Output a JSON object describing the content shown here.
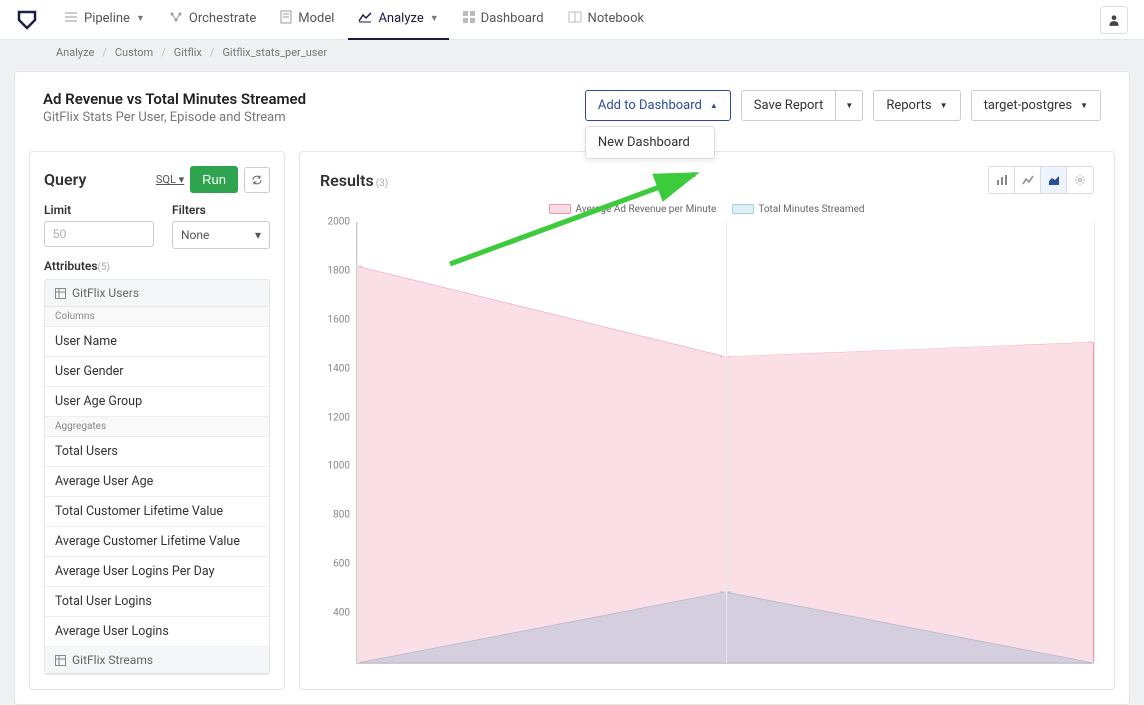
{
  "nav": {
    "items": [
      {
        "label": "Pipeline",
        "dropdown": true
      },
      {
        "label": "Orchestrate",
        "dropdown": false
      },
      {
        "label": "Model",
        "dropdown": false
      },
      {
        "label": "Analyze",
        "dropdown": true,
        "active": true
      },
      {
        "label": "Dashboard",
        "dropdown": false
      },
      {
        "label": "Notebook",
        "dropdown": false
      }
    ]
  },
  "breadcrumb": [
    "Analyze",
    "Custom",
    "Gitflix",
    "Gitflix_stats_per_user"
  ],
  "page": {
    "title": "Ad Revenue vs Total Minutes Streamed",
    "subtitle": "GitFlix Stats Per User, Episode and Stream"
  },
  "actions": {
    "add_to_dashboard": "Add to Dashboard",
    "save_report": "Save Report",
    "reports": "Reports",
    "connection": "target-postgres",
    "dropdown_item": "New Dashboard"
  },
  "query": {
    "title": "Query",
    "sql_label": "SQL",
    "run_label": "Run",
    "limit_label": "Limit",
    "limit_placeholder": "50",
    "filters_label": "Filters",
    "filters_value": "None",
    "attributes_label": "Attributes",
    "attributes_count": "(5)",
    "groups": [
      {
        "name": "GitFlix Users",
        "columns": [
          "User Name",
          "User Gender",
          "User Age Group"
        ],
        "aggregates": [
          "Total Users",
          "Average User Age",
          "Total Customer Lifetime Value",
          "Average Customer Lifetime Value",
          "Average User Logins Per Day",
          "Total User Logins",
          "Average User Logins"
        ]
      },
      {
        "name": "GitFlix Streams"
      }
    ],
    "columns_label": "Columns",
    "aggregates_label": "Aggregates"
  },
  "results": {
    "title": "Results",
    "count": "(3)"
  },
  "chart_data": {
    "type": "area",
    "ylim": [
      200,
      2000
    ],
    "yticks": [
      2000,
      1800,
      1600,
      1400,
      1200,
      1000,
      800,
      600,
      400
    ],
    "x": [
      0,
      1,
      2
    ],
    "series": [
      {
        "name": "Average Ad Revenue per Minute",
        "color": "rgba(231,110,140,.6)",
        "fill": "rgba(231,110,140,.22)",
        "values": [
          1820,
          1450,
          1510
        ]
      },
      {
        "name": "Total Minutes Streamed",
        "color": "rgba(110,140,170,.6)",
        "fill": "rgba(120,160,200,.28)",
        "values": [
          200,
          490,
          200
        ]
      }
    ],
    "gridlines_x": [
      0,
      1,
      2
    ]
  }
}
